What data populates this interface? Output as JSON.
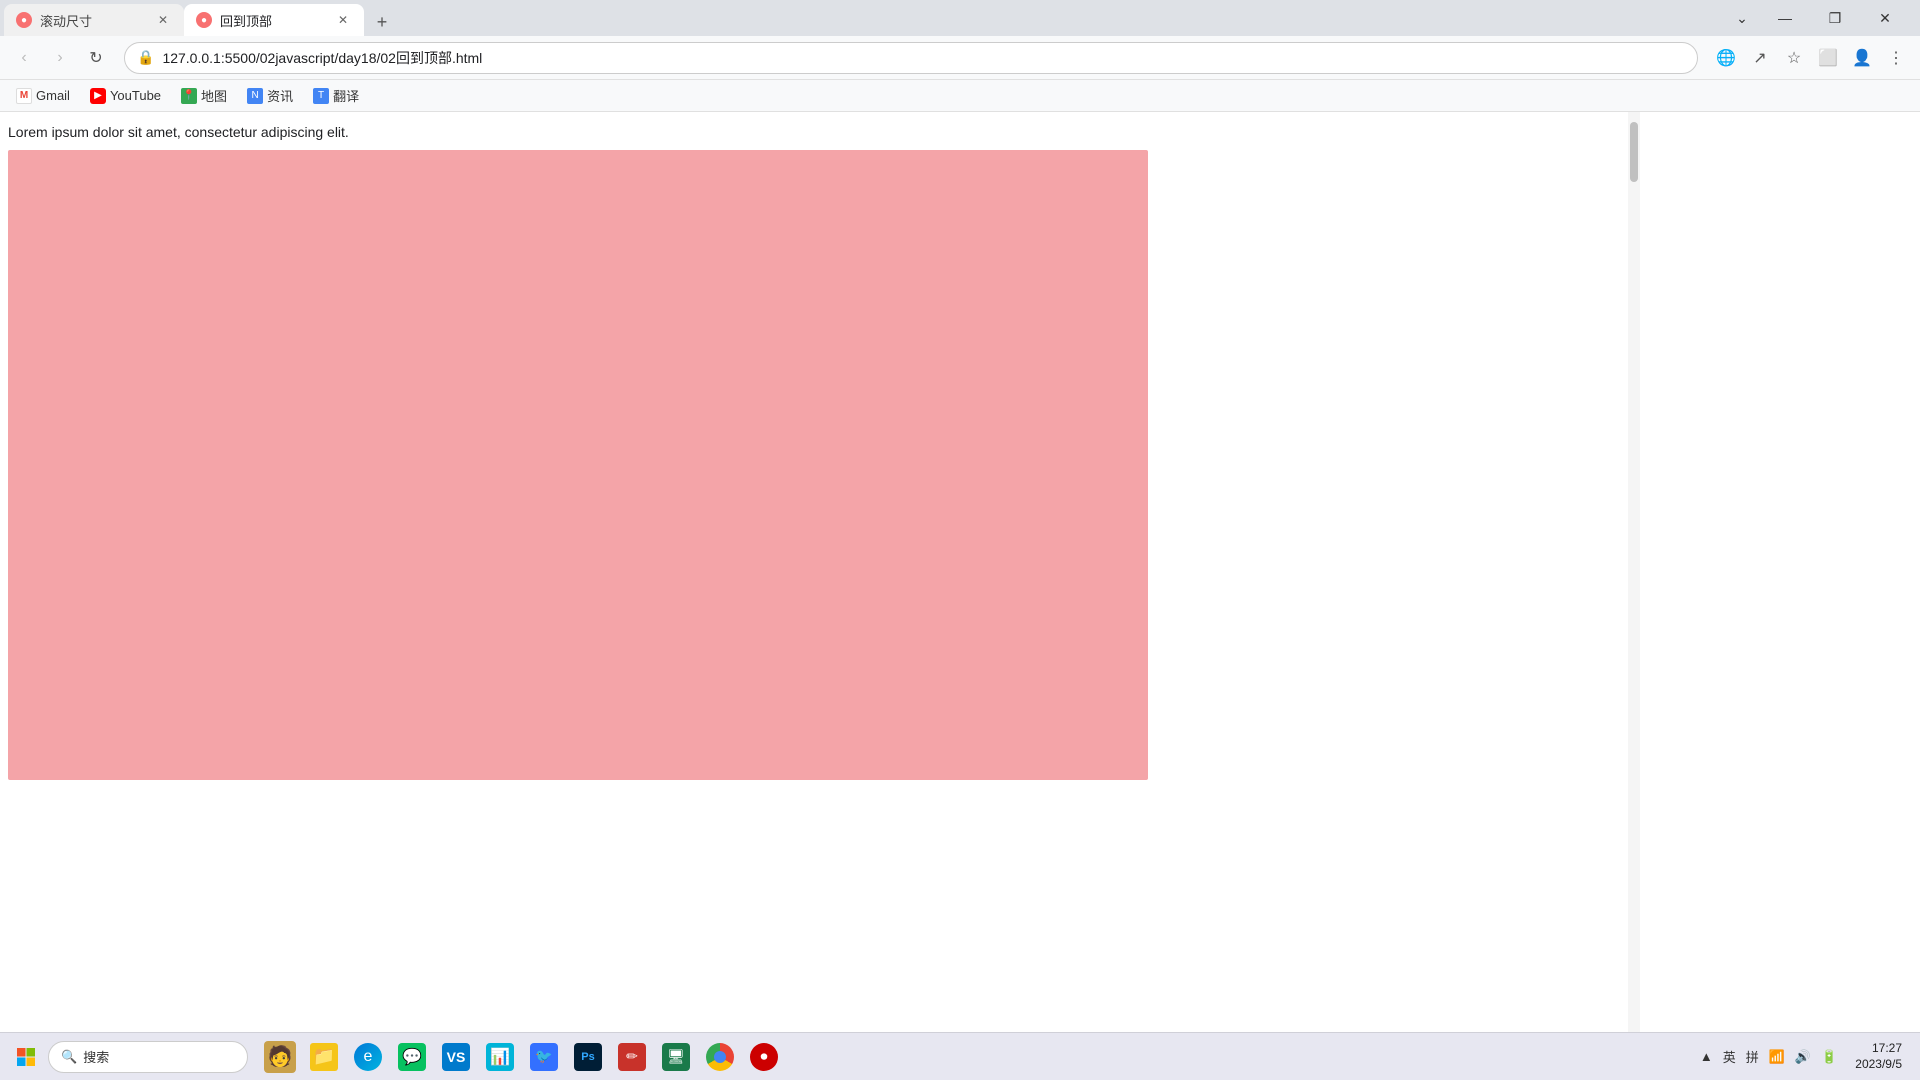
{
  "browser": {
    "tabs": [
      {
        "id": "tab1",
        "title": "滚动尺寸",
        "active": false,
        "favicon_color": "#f87171",
        "favicon_char": "●"
      },
      {
        "id": "tab2",
        "title": "回到顶部",
        "active": true,
        "favicon_color": "#f87171",
        "favicon_char": "●"
      }
    ],
    "new_tab_label": "+",
    "address": "127.0.0.1:5500/02javascript/day18/02回到顶部.html",
    "controls": {
      "minimize": "—",
      "maximize": "❐",
      "close": "✕",
      "tabs_menu": "⌄"
    }
  },
  "toolbar": {
    "back_label": "‹",
    "forward_label": "›",
    "reload_label": "↻",
    "lock_icon": "🔒"
  },
  "bookmarks": [
    {
      "id": "bm1",
      "label": "Gmail",
      "icon_color": "#fff",
      "icon_text": "M"
    },
    {
      "id": "bm2",
      "label": "YouTube",
      "icon_color": "#ff0000",
      "icon_text": "▶"
    },
    {
      "id": "bm3",
      "label": "地图",
      "icon_color": "#34a853",
      "icon_text": "📍"
    },
    {
      "id": "bm4",
      "label": "资讯",
      "icon_color": "#4285f4",
      "icon_text": "N"
    },
    {
      "id": "bm5",
      "label": "翻译",
      "icon_color": "#4285f4",
      "icon_text": "T"
    }
  ],
  "page": {
    "lorem_text": "Lorem ipsum dolor sit amet, consectetur adipiscing elit.",
    "pink_box_color": "#f4a4a8"
  },
  "taskbar": {
    "search_placeholder": "搜索",
    "time": "17:27",
    "date": "2023/9/5",
    "ime_english": "英",
    "ime_pinyin": "拼",
    "tray_icons": [
      "▲",
      "英",
      "拼",
      "🔊",
      "🔋",
      "📶"
    ]
  }
}
